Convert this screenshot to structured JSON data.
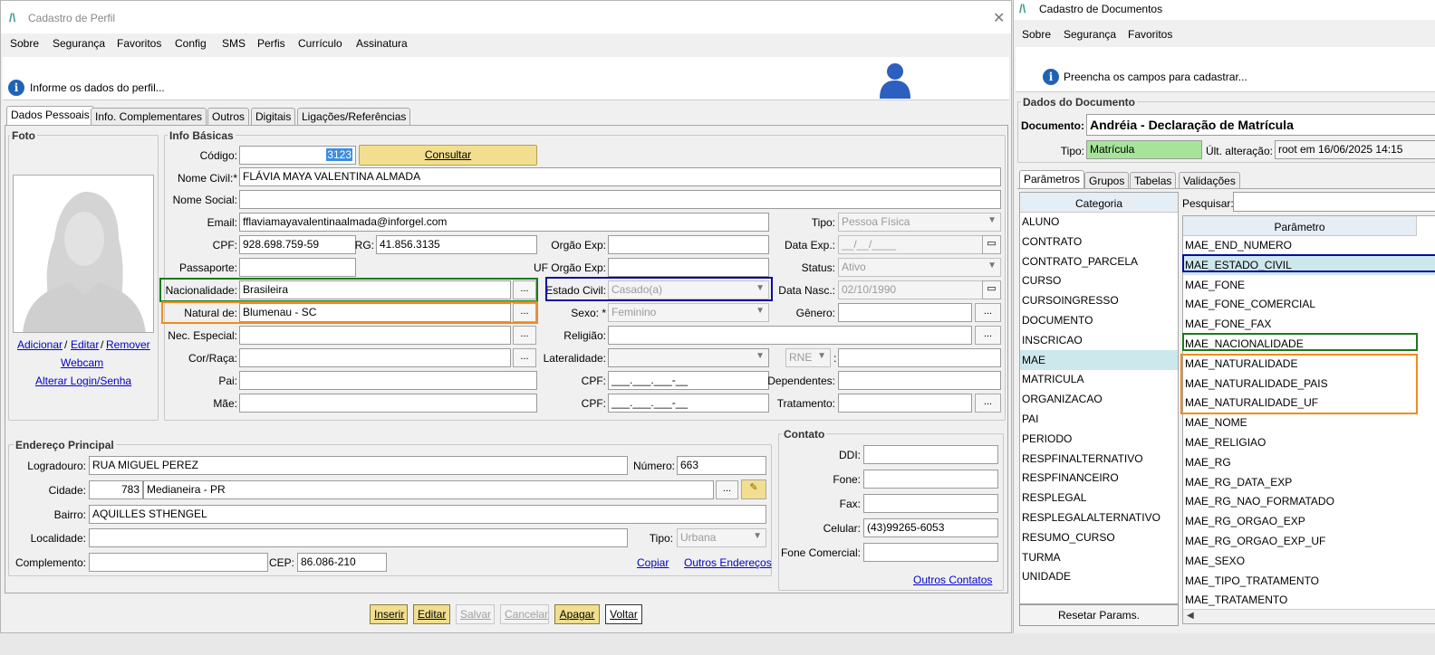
{
  "left": {
    "title": "Cadastro de Perfil",
    "menu": [
      "Sobre",
      "Segurança",
      "Favoritos",
      "Config",
      "SMS",
      "Perfis",
      "Currículo",
      "Assinatura"
    ],
    "info": "Informe os dados do perfil...",
    "tabs": [
      "Dados Pessoais",
      "Info. Complementares",
      "Outros",
      "Digitais",
      "Ligações/Referências"
    ],
    "foto": {
      "title": "Foto",
      "adicionar": "Adicionar",
      "sep1": "/",
      "editar": "Editar",
      "sep2": "/",
      "remover": "Remover",
      "webcam": "Webcam",
      "alterar": "Alterar Login/Senha"
    },
    "info_basicas": {
      "title": "Info Básicas",
      "codigo_label": "Código:",
      "codigo": "3123",
      "consultar": "Consultar",
      "nome_civil_label": "Nome Civil:*",
      "nome_civil": "FLÁVIA MAYA VALENTINA ALMADA",
      "nome_social_label": "Nome Social:",
      "email_label": "Email:",
      "email": "fflaviamayavalentinaalmada@inforgel.com",
      "tipo_label": "Tipo:",
      "tipo": "Pessoa Física",
      "cpf_label": "CPF:",
      "cpf": "928.698.759-59",
      "rg_label": "RG:",
      "rg": "41.856.3135",
      "orgao_exp_label": "Orgão Exp:",
      "data_exp_label": "Data Exp.:",
      "data_exp": "__/__/____",
      "passaporte_label": "Passaporte:",
      "uf_orgao_label": "UF Orgão Exp:",
      "status_label": "Status:",
      "status": "Ativo",
      "nacionalidade_label": "Nacionalidade:",
      "nacionalidade": "Brasileira",
      "estado_civil_label": "Estado Civil:",
      "estado_civil": "Casado(a)",
      "data_nasc_label": "Data Nasc.:",
      "data_nasc": "02/10/1990",
      "natural_label": "Natural de:",
      "natural": "Blumenau - SC",
      "sexo_label": "Sexo: *",
      "sexo": "Feminino",
      "genero_label": "Gênero:",
      "nec_label": "Nec. Especial:",
      "religiao_label": "Religião:",
      "cor_label": "Cor/Raça:",
      "lateralidade_label": "Lateralidade:",
      "rne": "RNE",
      "colon": ":",
      "pai_label": "Pai:",
      "cpf2_label": "CPF:",
      "cpf2": "___.___.___-__",
      "dependentes_label": "Dependentes:",
      "mae_label": "Mãe:",
      "cpf3_label": "CPF:",
      "cpf3": "___.___.___-__",
      "tratamento_label": "Tratamento:",
      "dots": "..."
    },
    "endereco": {
      "title": "Endereço Principal",
      "logradouro_label": "Logradouro:",
      "logradouro": "RUA MIGUEL PEREZ",
      "numero_label": "Número:",
      "numero": "663",
      "cidade_label": "Cidade:",
      "cidade_cod": "783",
      "cidade": "Medianeira - PR",
      "bairro_label": "Bairro:",
      "bairro": "AQUILLES STHENGEL",
      "localidade_label": "Localidade:",
      "tipo_label": "Tipo:",
      "tipo": "Urbana",
      "complemento_label": "Complemento:",
      "cep_label": "CEP:",
      "cep": "86.086-210",
      "copiar": "Copiar",
      "outros": "Outros Endereços"
    },
    "contato": {
      "title": "Contato",
      "ddi_label": "DDI:",
      "fone_label": "Fone:",
      "fax_label": "Fax:",
      "celular_label": "Celular:",
      "celular": "(43)99265-6053",
      "fone_com_label": "Fone Comercial:",
      "outros": "Outros Contatos"
    },
    "buttons": [
      "Inserir",
      "Editar",
      "Salvar",
      "Cancelar",
      "Apagar",
      "Voltar"
    ]
  },
  "right": {
    "title": "Cadastro de Documentos",
    "menu": [
      "Sobre",
      "Segurança",
      "Favoritos"
    ],
    "info": "Preencha os campos para cadastrar...",
    "dados_title": "Dados do Documento",
    "documento_label": "Documento:",
    "documento": "Andréia - Declaração de Matrícula",
    "tipo_label": "Tipo:",
    "tipo": "Matrícula",
    "ult_label": "Últ. alteração:",
    "ult": "root em 16/06/2025 14:15",
    "tabs": [
      "Parâmetros",
      "Grupos",
      "Tabelas",
      "Validações"
    ],
    "categoria_header": "Categoria",
    "categorias": [
      "ALUNO",
      "CONTRATO",
      "CONTRATO_PARCELA",
      "CURSO",
      "CURSOINGRESSO",
      "DOCUMENTO",
      "INSCRICAO",
      "MAE",
      "MATRICULA",
      "ORGANIZACAO",
      "PAI",
      "PERIODO",
      "RESPFINALTERNATIVO",
      "RESPFINANCEIRO",
      "RESPLEGAL",
      "RESPLEGALALTERNATIVO",
      "RESUMO_CURSO",
      "TURMA",
      "UNIDADE"
    ],
    "pesquisar_label": "Pesquisar:",
    "parametro_header": "Parâmetro",
    "parametros": [
      "MAE_END_NUMERO",
      "MAE_ESTADO_CIVIL",
      "MAE_FONE",
      "MAE_FONE_COMERCIAL",
      "MAE_FONE_FAX",
      "MAE_NACIONALIDADE",
      "MAE_NATURALIDADE",
      "MAE_NATURALIDADE_PAIS",
      "MAE_NATURALIDADE_UF",
      "MAE_NOME",
      "MAE_RELIGIAO",
      "MAE_RG",
      "MAE_RG_DATA_EXP",
      "MAE_RG_NAO_FORMATADO",
      "MAE_RG_ORGAO_EXP",
      "MAE_RG_ORGAO_EXP_UF",
      "MAE_SEXO",
      "MAE_TIPO_TRATAMENTO",
      "MAE_TRATAMENTO"
    ],
    "resetar": "Resetar Params."
  },
  "colors": {
    "green": "#1a7a1a",
    "blue": "#0a0aa0",
    "orange": "#f08c1a",
    "mae_row": "#cde8ec",
    "tipo_bg": "#a6e49a",
    "consultar": "#f1df8f"
  }
}
